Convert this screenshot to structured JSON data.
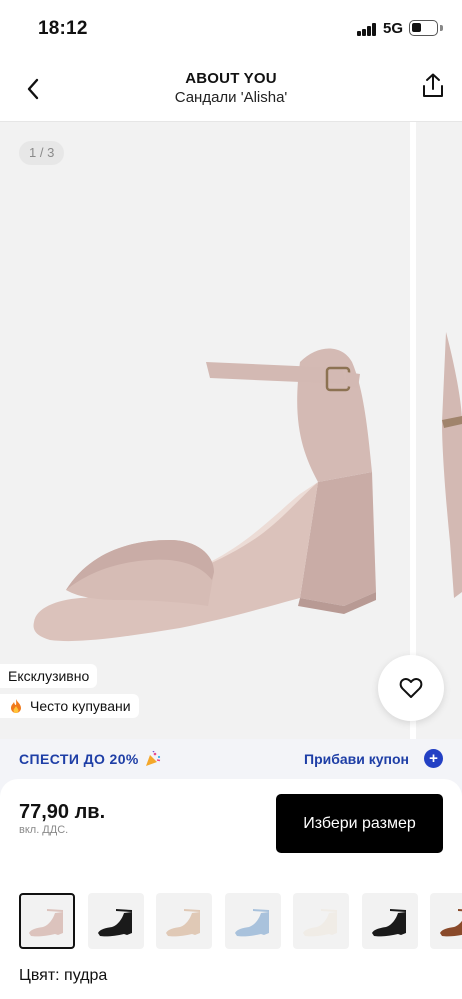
{
  "status_bar": {
    "time": "18:12",
    "network": "5G"
  },
  "header": {
    "brand": "ABOUT YOU",
    "product_name": "Сандали 'Alisha'"
  },
  "gallery": {
    "counter": "1 / 3",
    "badges": {
      "exclusive": "Ексклузивно",
      "popular": "Често купувани"
    },
    "product_color": "#dcc3bd"
  },
  "coupon": {
    "promo": "СПЕСТИ ДО 20%",
    "action": "Прибави купон",
    "accent": "#1e3ea6"
  },
  "pricing": {
    "price": "77,90 лв.",
    "vat_note": "вкл. ДДС.",
    "select_size": "Избери размер"
  },
  "variants": {
    "colors": [
      "#dcc3bd",
      "#1a1a1a",
      "#e0c9b6",
      "#a9c2dc",
      "#f0ece6",
      "#1a1a1a",
      "#8a4a2a"
    ],
    "selected_index": 0,
    "color_label": "Цвят: пудра"
  }
}
